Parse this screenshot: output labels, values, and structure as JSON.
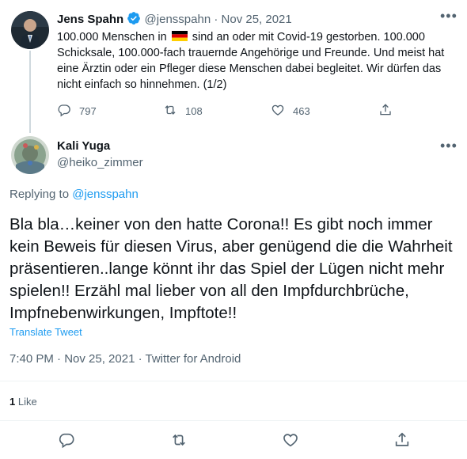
{
  "parent": {
    "name": "Jens Spahn",
    "handle": "@jensspahn",
    "separator": "·",
    "date": "Nov 25, 2021",
    "text_part1": "100.000 Menschen in",
    "text_part2": "sind an oder mit Covid-19 gestorben. 100.000 Schicksale, 100.000-fach trauernde Angehörige und Freunde. Und meist hat eine Ärztin oder ein Pfleger diese Menschen dabei begleitet. Wir dürfen das nicht einfach so hinnehmen. (1/2)",
    "flag_icon": "germany-flag-icon",
    "replies": "797",
    "retweets": "108",
    "likes": "463"
  },
  "reply": {
    "name": "Kali Yuga",
    "handle": "@heiko_zimmer",
    "replying_prefix": "Replying to",
    "replying_to": "@jensspahn",
    "text": "Bla bla…keiner von den hatte Corona!! Es gibt noch immer kein Beweis für diesen Virus, aber genügend die die Wahrheit präsentieren..lange könnt ihr das Spiel der Lügen nicht mehr spielen!! Erzähl mal lieber von all den Impfdurchbrüche, Impfnebenwirkungen, Impftote!!",
    "translate": "Translate Tweet",
    "timestamp": "7:40 PM · Nov 25, 2021 · Twitter for Android",
    "like_count": "1",
    "like_label": "Like"
  },
  "colors": {
    "accent": "#1d9bf0",
    "muted": "#536471",
    "text": "#0f1419",
    "divider": "#eff3f4"
  }
}
